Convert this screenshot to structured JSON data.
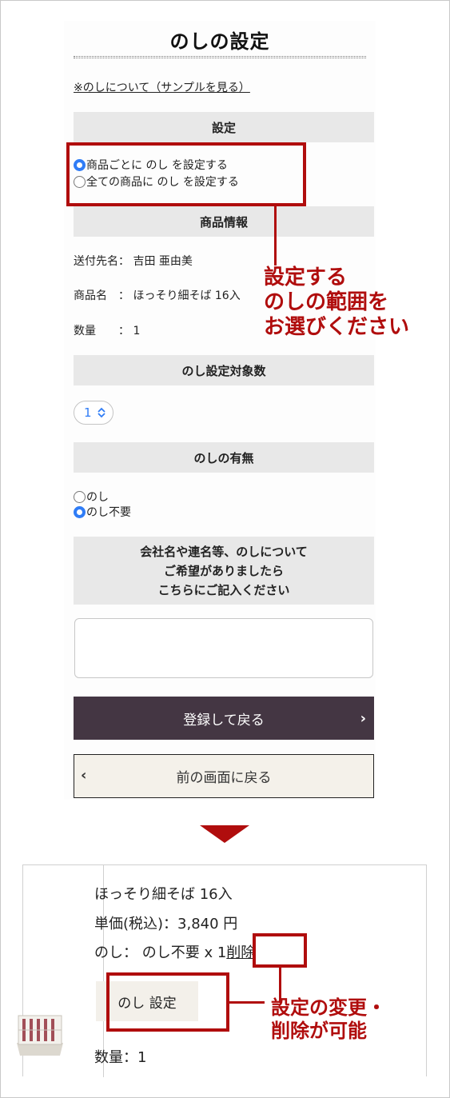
{
  "form": {
    "title": "のしの設定",
    "sample_link": "※のしについて（サンプルを見る）",
    "setting": {
      "header": "設定",
      "options": [
        {
          "label": "商品ごとに のし を設定する",
          "selected": true
        },
        {
          "label": "全ての商品に のし を設定する",
          "selected": false
        }
      ]
    },
    "product_info": {
      "header": "商品情報",
      "recipient": "送付先名： 吉田 亜由美",
      "product_name": "商品名　： ほっそり細そば 16入",
      "quantity": "数量　　： 1"
    },
    "target_count": {
      "header": "のし設定対象数",
      "selected_value": "1"
    },
    "noshi_presence": {
      "header": "のしの有無",
      "options": [
        {
          "label": "のし",
          "selected": false
        },
        {
          "label": "のし不要",
          "selected": true
        }
      ]
    },
    "comment": {
      "header_lines": [
        "会社名や連名等、のしについて",
        "ご希望がありましたら",
        "こちらにご記入ください"
      ],
      "value": ""
    },
    "submit_button": "登録して戻る",
    "back_button": "前の画面に戻る"
  },
  "callouts": {
    "scope_lines": [
      "設定する",
      "のしの範囲を",
      "お選びください"
    ],
    "change_lines": [
      "設定の変更・",
      "削除が可能"
    ]
  },
  "cart_item": {
    "name": "ほっそり細そば 16入",
    "price": "単価(税込)：3,840 円",
    "noshi_prefix": "のし：  のし不要  x 1",
    "delete_link": "削除",
    "noshi_button": "のし 設定",
    "quantity": "数量：1"
  },
  "colors": {
    "accent_red": "#b00d0d",
    "primary_button": "#443643",
    "radio_selected": "#2f7cf6",
    "section_bar": "#e8e8e8"
  }
}
